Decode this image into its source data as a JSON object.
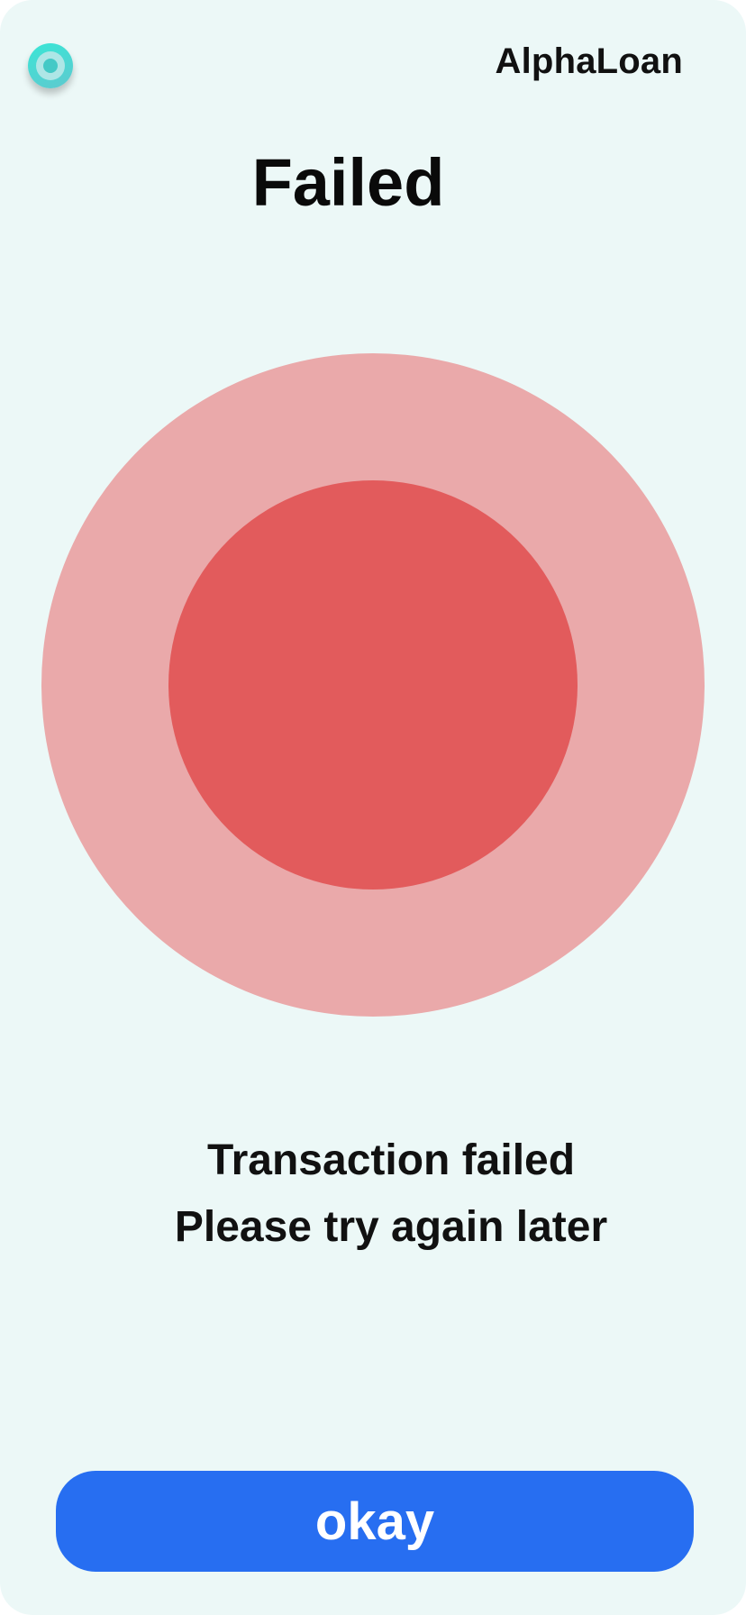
{
  "header": {
    "brand": "AlphaLoan",
    "logo_icon": "target-icon"
  },
  "page": {
    "title": "Failed"
  },
  "status": {
    "icon": "failed-status-circle",
    "outer_color": "#eaa9aa",
    "inner_color": "#e25b5c"
  },
  "message": {
    "line1": "Transaction failed",
    "line2": "Please try again later"
  },
  "actions": {
    "okay_label": "okay",
    "okay_color": "#276ef1"
  },
  "colors": {
    "background": "#ecf8f7",
    "logo_accent": "#39e6d6"
  }
}
